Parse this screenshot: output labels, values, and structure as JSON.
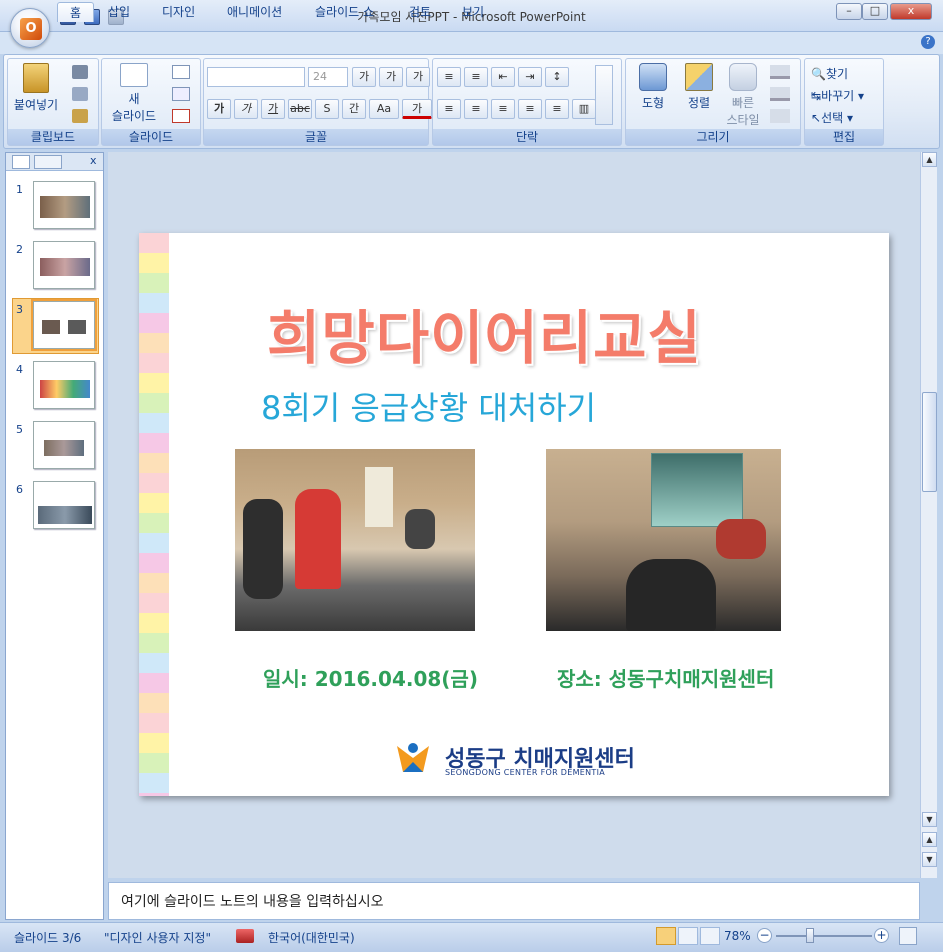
{
  "window": {
    "title": "가족모임 사진PPT - Microsoft PowerPoint",
    "minimize": "–",
    "maximize": "□",
    "close": "x"
  },
  "ribbon_tabs": [
    "홈",
    "삽입",
    "디자인",
    "애니메이션",
    "슬라이드 쇼",
    "검토",
    "보기"
  ],
  "groups": {
    "clipboard": {
      "label": "클립보드",
      "paste": "붙여넣기"
    },
    "slides": {
      "label": "슬라이드",
      "new_slide_line1": "새",
      "new_slide_line2": "슬라이드"
    },
    "font": {
      "label": "글꼴",
      "font_size": "24",
      "grow": "가",
      "shrink": "가",
      "clear": "가",
      "bold": "가",
      "italic": "가",
      "underline": "가",
      "strike": "abc",
      "shadow": "S",
      "spacing": "간",
      "case": "Aa",
      "color": "가"
    },
    "paragraph": {
      "label": "단락"
    },
    "drawing": {
      "label": "그리기",
      "shapes": "도형",
      "arrange": "정렬",
      "quick_styles_line1": "빠른",
      "quick_styles_line2": "스타일"
    },
    "editing": {
      "label": "편집",
      "find": "찾기",
      "replace": "바꾸기",
      "select": "선택"
    }
  },
  "thumbnails": [
    {
      "num": "1"
    },
    {
      "num": "2"
    },
    {
      "num": "3"
    },
    {
      "num": "4"
    },
    {
      "num": "5"
    },
    {
      "num": "6"
    }
  ],
  "slide": {
    "title": "희망다이어리교실",
    "subtitle": "8회기 응급상황 대처하기",
    "date": "일시: 2016.04.08(금)",
    "place": "장소: 성동구치매지원센터",
    "org_name": "성동구 치매지원센터",
    "org_name_en": "SEONGDONG CENTER FOR DEMENTIA"
  },
  "notes_placeholder": "여기에 슬라이드 노트의 내용을 입력하십시오",
  "status": {
    "slide_count": "슬라이드 3/6",
    "theme": "\"디자인 사용자 지정\"",
    "language": "한국어(대한민국)",
    "zoom": "78%"
  },
  "colors": {
    "title": "#f47c6a",
    "subtitle": "#27a7d8",
    "info": "#2fa05a",
    "selected_thumb": "#fbd48b"
  }
}
